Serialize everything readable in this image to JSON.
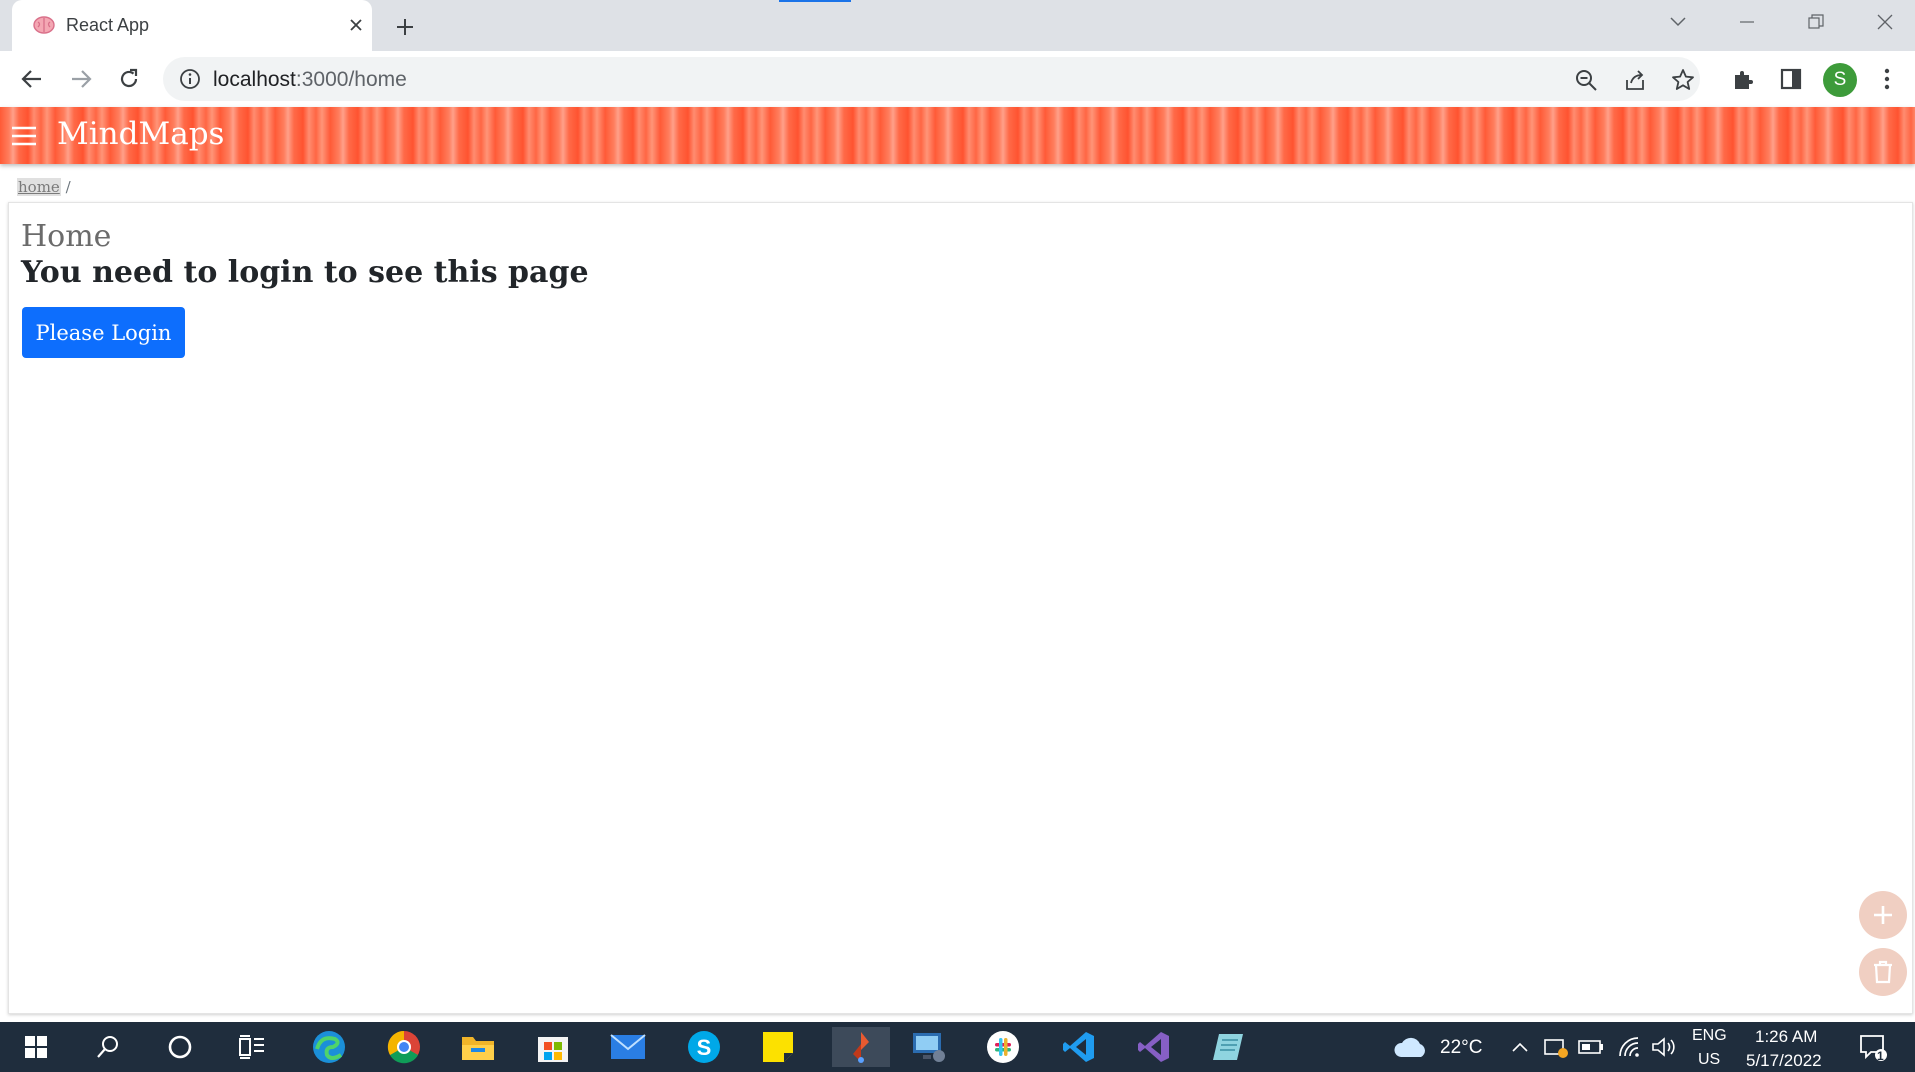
{
  "browser": {
    "tab_title": "React App",
    "url_host": "localhost",
    "url_path": ":3000/home",
    "profile_initial": "S"
  },
  "app": {
    "brand": "MindMaps",
    "breadcrumb": {
      "current": "home",
      "separator": "/"
    },
    "page_title": "Home",
    "login_notice": "You need to login to see this page",
    "login_button": "Please Login",
    "accent_color": "#ff5a36",
    "button_color": "#0d6efd"
  },
  "taskbar": {
    "weather": "22°C",
    "language": "ENG",
    "region": "US",
    "time": "1:26 AM",
    "date": "5/17/2022",
    "notification_count": "1",
    "icons": [
      "windows-start-icon",
      "search-icon",
      "cortana-icon",
      "task-view-icon",
      "edge-icon",
      "chrome-icon",
      "file-explorer-icon",
      "store-icon",
      "mail-icon",
      "skype-icon",
      "sticky-notes-icon",
      "active-app-icon",
      "remote-desktop-icon",
      "slack-icon",
      "vscode-icon",
      "visual-studio-icon",
      "notes-app-icon"
    ]
  }
}
